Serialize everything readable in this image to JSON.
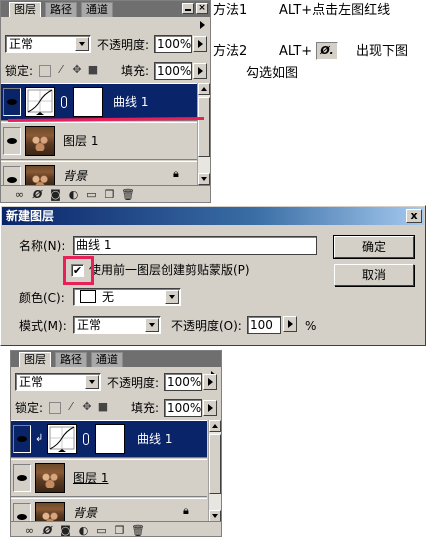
{
  "panel_top": {
    "tabs": [
      "图层",
      "路径",
      "通道"
    ],
    "blend_mode": "正常",
    "opacity_label": "不透明度:",
    "opacity_value": "100%",
    "lock_label": "锁定:",
    "fill_label": "填充:",
    "fill_value": "100%",
    "layers": [
      {
        "name": "曲线 1",
        "type": "adjustment",
        "selected": true
      },
      {
        "name": "图层 1",
        "type": "pixel",
        "selected": false
      },
      {
        "name": "背景",
        "type": "background",
        "selected": false
      }
    ]
  },
  "annotations": {
    "method1": "方法1",
    "method1_desc": "ALT+点击左图红线",
    "method2": "方法2",
    "method2_key": "ALT+",
    "method2_desc": "出现下图",
    "method2_desc2": "勾选如图"
  },
  "dialog": {
    "title": "新建图层",
    "close": "x",
    "name_label": "名称(N):",
    "name_value": "曲线 1",
    "checkbox_label": "使用前一图层创建剪贴蒙版(P)",
    "checkbox_checked": true,
    "color_label": "颜色(C):",
    "color_value": "无",
    "mode_label": "模式(M):",
    "mode_value": "正常",
    "opacity_label": "不透明度(O):",
    "opacity_value": "100",
    "opacity_unit": "%",
    "ok_label": "确定",
    "cancel_label": "取消"
  },
  "panel_bottom": {
    "tabs": [
      "图层",
      "路径",
      "通道"
    ],
    "blend_mode": "正常",
    "opacity_label": "不透明度:",
    "opacity_value": "100%",
    "lock_label": "锁定:",
    "fill_label": "填充:",
    "fill_value": "100%",
    "layers": [
      {
        "name": "曲线 1",
        "type": "adjustment-clipped",
        "selected": true
      },
      {
        "name": "图层 1",
        "type": "pixel",
        "selected": false
      },
      {
        "name": "背景",
        "type": "background",
        "selected": false
      }
    ]
  },
  "colors": {
    "selection": "#0a246a",
    "highlight": "#e8205a",
    "panel_bg": "#d4d0c8"
  }
}
